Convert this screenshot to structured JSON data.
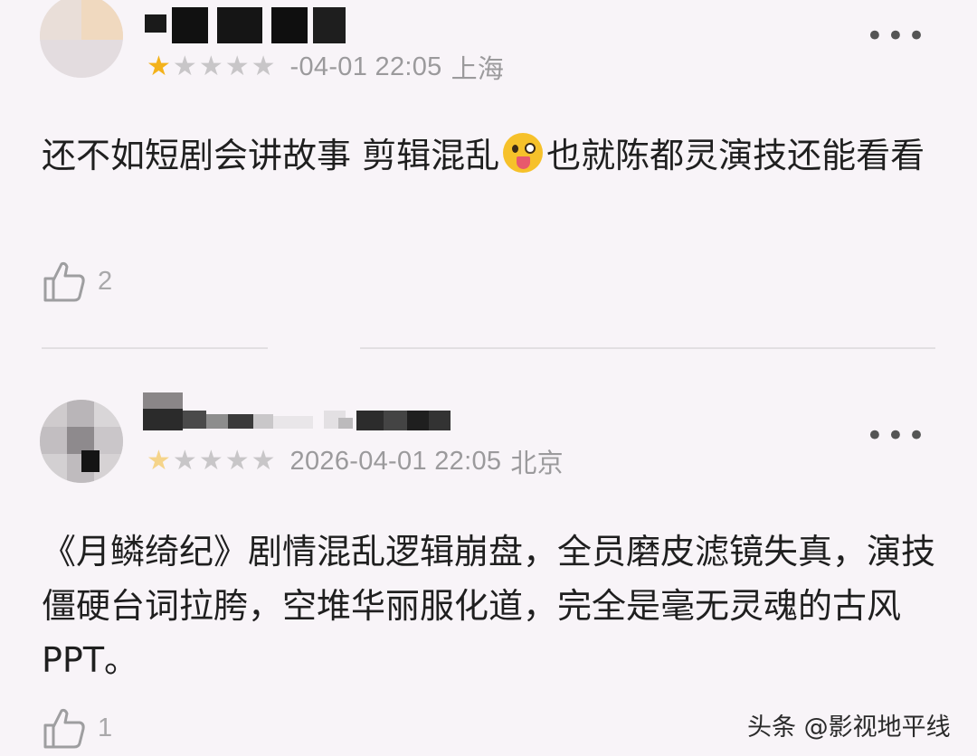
{
  "comments": [
    {
      "timestamp": "-04-01 22:05",
      "location": "上海",
      "rating": 1,
      "text_a": "还不如短剧会讲故事 剪辑混乱",
      "emoji": "winking-tongue-emoji",
      "text_b": "也就陈都灵演技还能看看",
      "likes": "2"
    },
    {
      "timestamp": "2026-04-01 22:05",
      "location": "北京",
      "rating": 1,
      "text": "《月鳞绮纪》剧情混乱逻辑崩盘，全员磨皮滤镜失真，演技僵硬台词拉胯，空堆华丽服化道，完全是毫无灵魂的古风PPT。",
      "likes": "1"
    }
  ],
  "more_label": "•••",
  "watermark": "头条 @影视地平线",
  "colors": {
    "background": "#f8f4f8",
    "star_active": "#f3b21b",
    "star_inactive": "#c8c6c8",
    "meta_text": "#9b9a9c"
  }
}
